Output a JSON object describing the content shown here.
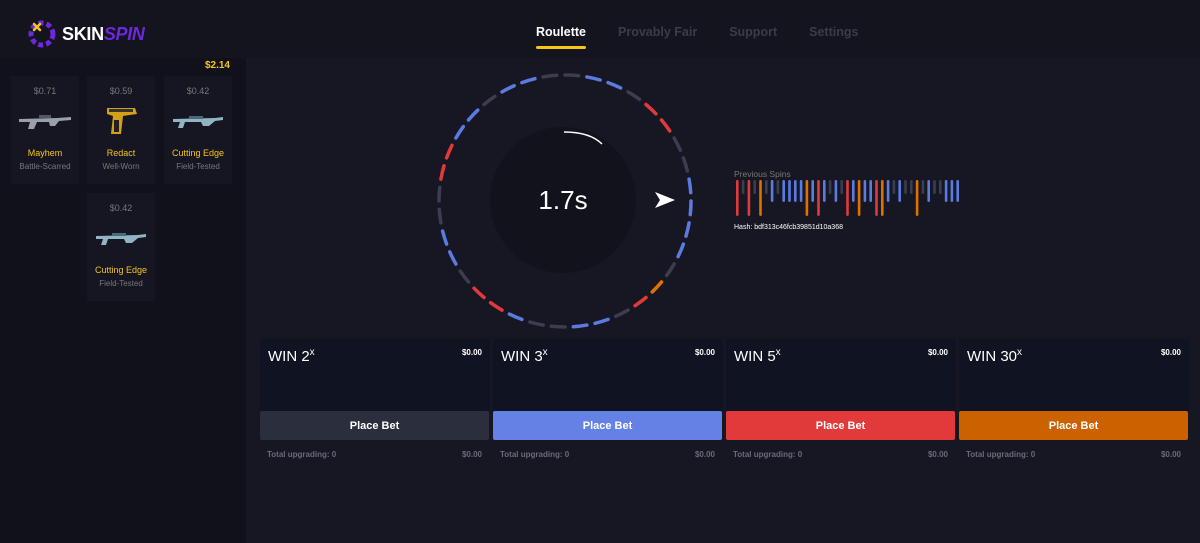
{
  "header": {
    "logo_part1": "SKIN",
    "logo_part2": "SPIN",
    "nav": [
      {
        "label": "Roulette",
        "active": true
      },
      {
        "label": "Provably Fair",
        "active": false
      },
      {
        "label": "Support",
        "active": false
      },
      {
        "label": "Settings",
        "active": false
      }
    ]
  },
  "sidebar": {
    "balance": "$2.14",
    "items": [
      {
        "price": "$0.71",
        "name": "Mayhem",
        "wear": "Battle-Scarred",
        "icon": "rifle-icon"
      },
      {
        "price": "$0.59",
        "name": "Redact",
        "wear": "Well-Worn",
        "icon": "pistol-icon"
      },
      {
        "price": "$0.42",
        "name": "Cutting Edge",
        "wear": "Field-Tested",
        "icon": "smg-icon"
      },
      {
        "price": "$0.42",
        "name": "Cutting Edge",
        "wear": "Field-Tested",
        "icon": "smg-icon"
      }
    ]
  },
  "roulette": {
    "timer": "1.7s",
    "previous_label": "Previous Spins",
    "hash": "Hash: bdf313c46fcb39851d10a368",
    "colors": {
      "gray": "#3b3e4f",
      "blue": "#5b7be0",
      "red": "#e23a3a",
      "orange": "#e07000"
    },
    "previous_spins": [
      "red",
      "gray",
      "red",
      "gray",
      "orange",
      "gray",
      "blue",
      "gray",
      "blue",
      "blue",
      "blue",
      "blue",
      "orange",
      "blue",
      "red",
      "blue",
      "gray",
      "blue",
      "gray",
      "red",
      "blue",
      "orange",
      "blue",
      "blue",
      "red",
      "orange",
      "blue",
      "gray",
      "blue",
      "gray",
      "gray",
      "orange",
      "gray",
      "blue",
      "gray",
      "gray",
      "blue",
      "blue",
      "blue"
    ]
  },
  "bets": [
    {
      "title": "WIN 2",
      "mult": "x",
      "amount": "$0.00",
      "button": "Place Bet",
      "footer_label": "Total upgrading: 0",
      "footer_amount": "$0.00",
      "color": "#2a2e3d"
    },
    {
      "title": "WIN 3",
      "mult": "x",
      "amount": "$0.00",
      "button": "Place Bet",
      "footer_label": "Total upgrading: 0",
      "footer_amount": "$0.00",
      "color": "#6482e6"
    },
    {
      "title": "WIN 5",
      "mult": "x",
      "amount": "$0.00",
      "button": "Place Bet",
      "footer_label": "Total upgrading: 0",
      "footer_amount": "$0.00",
      "color": "#e23a3a"
    },
    {
      "title": "WIN 30",
      "mult": "x",
      "amount": "$0.00",
      "button": "Place Bet",
      "footer_label": "Total upgrading: 0",
      "footer_amount": "$0.00",
      "color": "#cc6100"
    }
  ]
}
